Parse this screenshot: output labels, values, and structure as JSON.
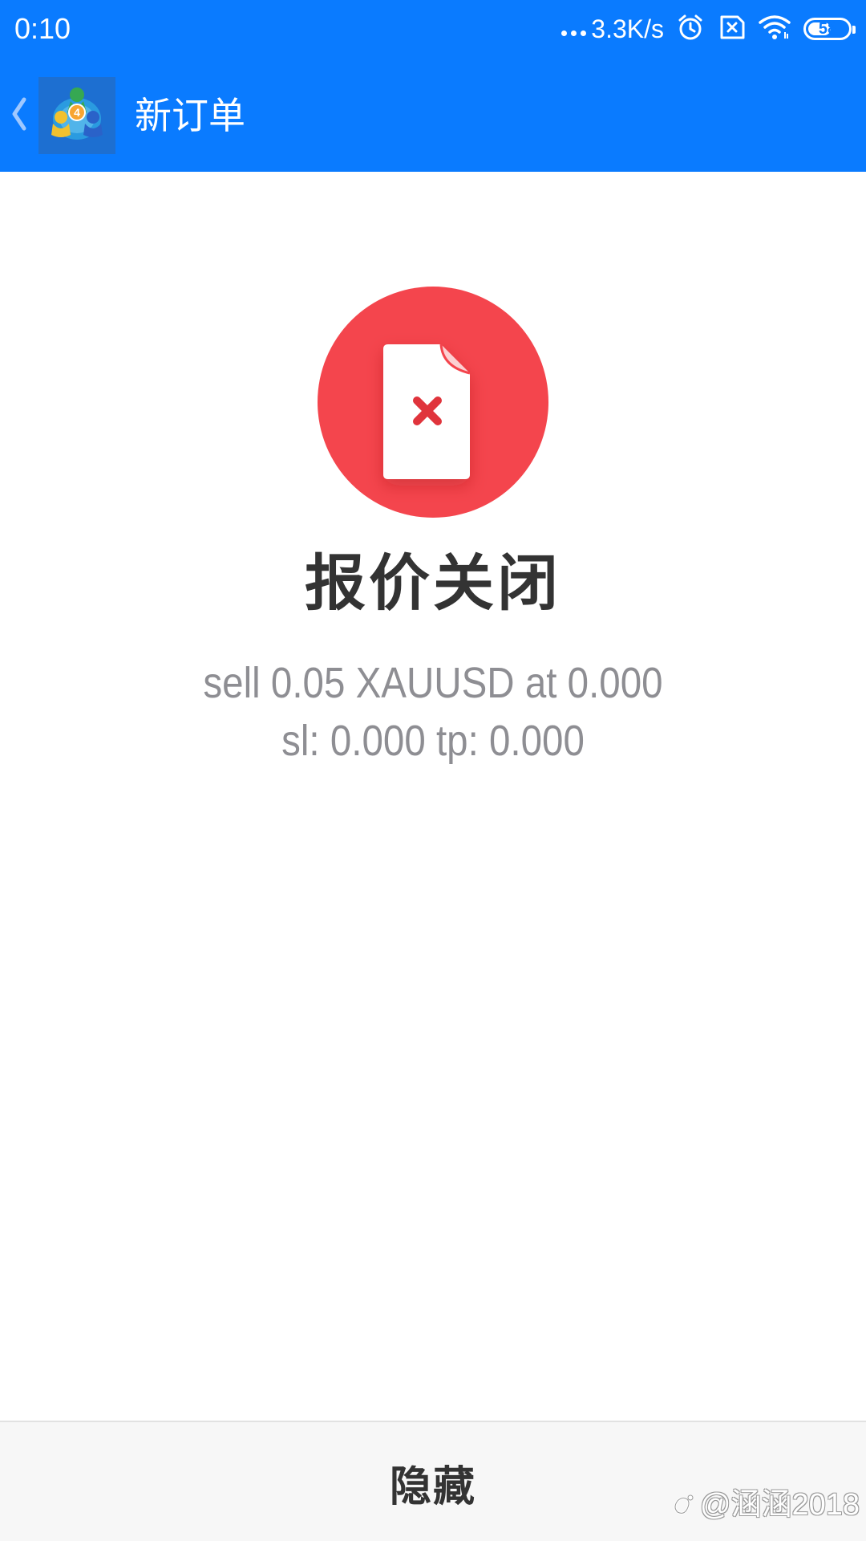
{
  "status_bar": {
    "time": "0:10",
    "network_speed": "3.3K/s",
    "battery_level": "58",
    "battery_fraction": 0.58
  },
  "app_bar": {
    "title": "新订单"
  },
  "result": {
    "title": "报价关闭",
    "order_line_1": "sell 0.05 XAUUSD at 0.000",
    "order_line_2": "sl: 0.000 tp: 0.000"
  },
  "bottom_bar": {
    "hide_label": "隐藏"
  },
  "watermark": {
    "text": "@涵涵2018"
  },
  "colors": {
    "primary": "#0a7bff",
    "error": "#f4454d",
    "title_text": "#333333",
    "secondary_text": "#8e8e93"
  },
  "icons": {
    "back": "chevron-left-icon",
    "app_logo": "metatrader-4-logo",
    "status": [
      "dots-icon",
      "alarm-icon",
      "sim-blocked-icon",
      "wifi-icon",
      "battery-icon"
    ],
    "result": "document-error-icon"
  }
}
